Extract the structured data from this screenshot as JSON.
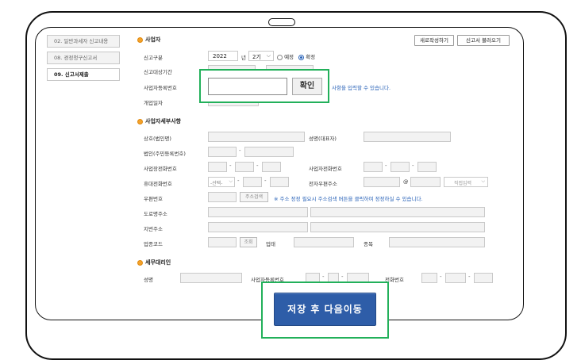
{
  "sidebar": {
    "items": [
      {
        "label": "02. 일반과세자 신고내용"
      },
      {
        "label": "08. 경정청구신고서"
      },
      {
        "label": "09. 신고서제출"
      }
    ]
  },
  "toolbar": {
    "new_label": "새로작성하기",
    "load_label": "신고서 불러오기"
  },
  "business": {
    "title": "사업자",
    "report_type_label": "신고구분",
    "year": "2022",
    "year_unit": "년",
    "period": "2기",
    "radio_scheduled": "예정",
    "radio_final": "확정",
    "period_label": "신고대상기간",
    "bizno_label": "사업자등록번호",
    "bizno_hint": "사항을 입력할 수 있습니다.",
    "open_date_label": "개업일자"
  },
  "popup": {
    "input_value": "",
    "confirm_label": "확인"
  },
  "details": {
    "title": "사업자세부사항",
    "trade_name_label": "상호(법인명)",
    "ceo_label": "성명(대표자)",
    "corp_no_label": "법인(주민등록번호)",
    "biz_phone_label": "사업장전화번호",
    "home_phone_label": "사업자전화번호",
    "mobile_label": "휴대전화번호",
    "mobile_select": "-선택-",
    "email_label": "전자우편주소",
    "email_at": "@",
    "email_domain": "직접입력",
    "zip_label": "우편번호",
    "zip_btn": "주소검색",
    "zip_note": "※ 주소 정정 필요시 주소검색 버튼을 클릭하여 정정하실 수 있습니다.",
    "road_label": "도로명주소",
    "lot_label": "지번주소",
    "industry_label": "업종코드",
    "search_btn": "조회",
    "biz_type_label": "업태",
    "item_label": "종목"
  },
  "agent": {
    "title": "세무대리인",
    "name_label": "성명",
    "bizno_label": "사업자등록번호",
    "phone_label": "전화번호"
  },
  "save_button": {
    "label": "저장 후 다음이동"
  },
  "colors": {
    "accent_dot": "#f4a22a",
    "primary_button": "#2e5da8",
    "highlight": "#22b05a",
    "link": "#2a63b8"
  }
}
